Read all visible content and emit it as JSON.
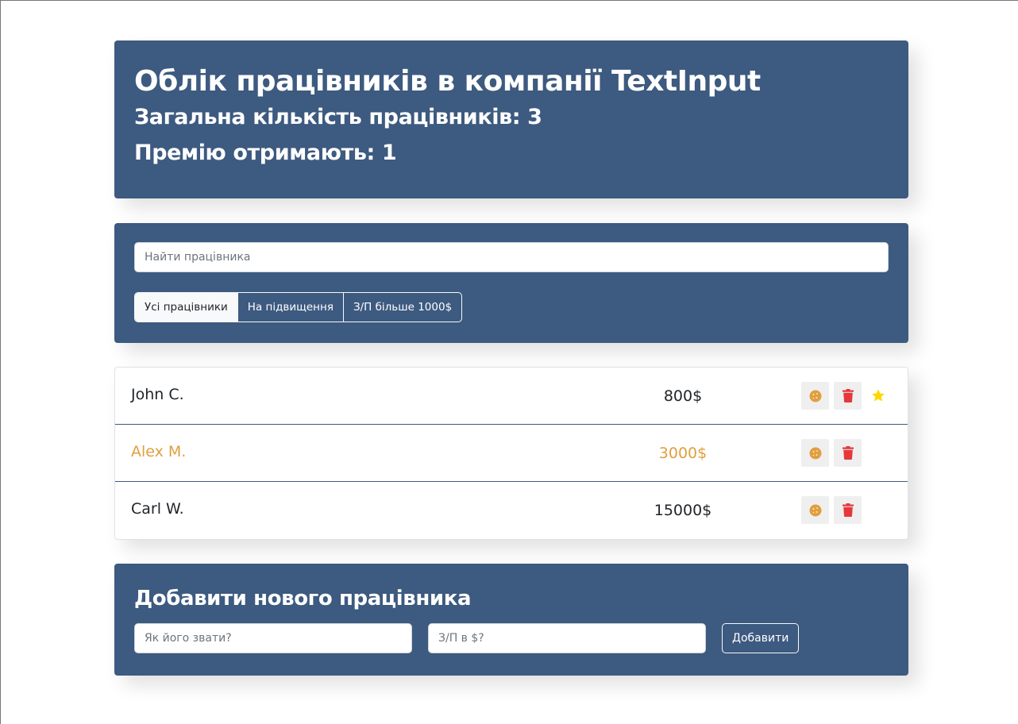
{
  "header": {
    "title": "Облік працівників в компанії TextInput",
    "total_line": "Загальна кількість працівників: 3",
    "bonus_line": "Премію отримають: 1"
  },
  "search": {
    "placeholder": "Найти працівника",
    "value": ""
  },
  "filters": [
    {
      "label": "Усі працівники",
      "active": true
    },
    {
      "label": "На підвищення",
      "active": false
    },
    {
      "label": "З/П більше 1000$",
      "active": false
    }
  ],
  "employees": [
    {
      "name": "John C.",
      "salary": "800$",
      "increase": false,
      "star": true
    },
    {
      "name": "Alex M.",
      "salary": "3000$",
      "increase": true,
      "star": false
    },
    {
      "name": "Carl W.",
      "salary": "15000$",
      "increase": false,
      "star": false
    }
  ],
  "add_form": {
    "title": "Добавити нового працівника",
    "name_placeholder": "Як його звати?",
    "salary_placeholder": "З/П в $?",
    "submit_label": "Добавити"
  },
  "colors": {
    "panel_bg": "#3d5a80",
    "increase_text": "#e09f3e",
    "cookie_icon": "#e09f3e",
    "trash_icon": "#e5383b",
    "star_icon": "#ffd700"
  },
  "icons": {
    "increase": "cookie-icon",
    "delete": "trash-icon",
    "bonus": "star-icon"
  }
}
